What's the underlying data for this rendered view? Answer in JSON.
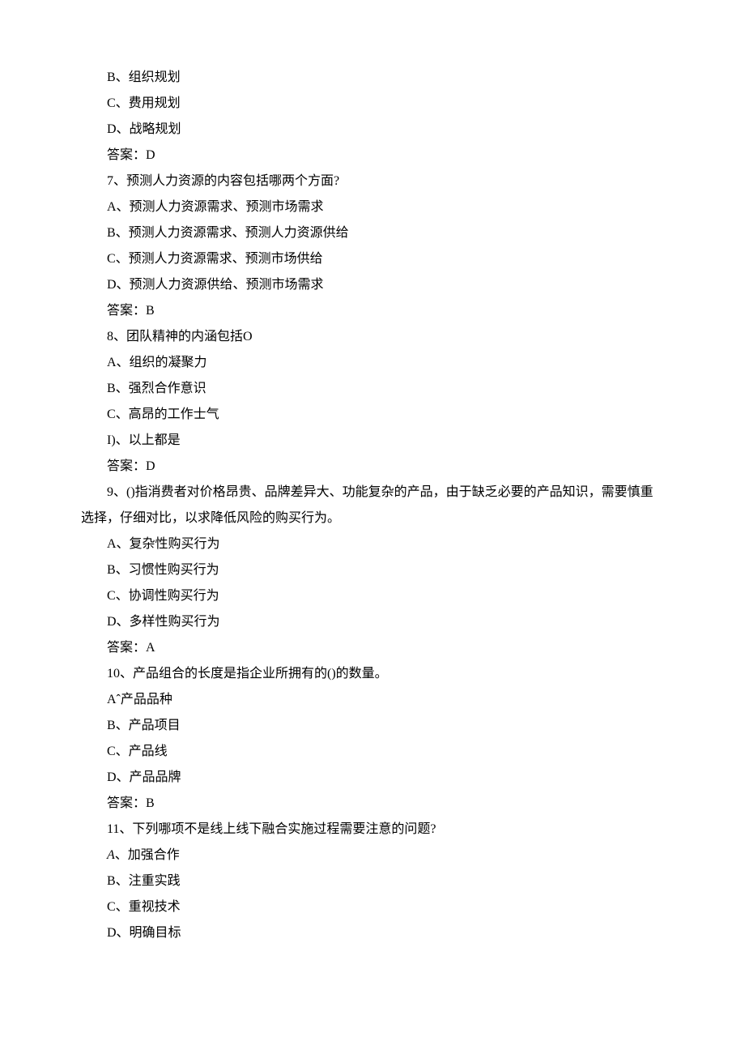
{
  "lines": [
    {
      "text": "B、组织规划",
      "indent": true
    },
    {
      "text": "C、费用规划",
      "indent": true
    },
    {
      "text": "D、战略规划",
      "indent": true
    },
    {
      "text": "答案：D",
      "indent": true
    },
    {
      "text": "7、预测人力资源的内容包括哪两个方面?",
      "indent": true
    },
    {
      "text": "A、预测人力资源需求、预测市场需求",
      "indent": true
    },
    {
      "text": "B、预测人力资源需求、预测人力资源供给",
      "indent": true
    },
    {
      "text": "C、预测人力资源需求、预测市场供给",
      "indent": true
    },
    {
      "text": "D、预测人力资源供给、预测市场需求",
      "indent": true
    },
    {
      "text": "答案：B",
      "indent": true
    },
    {
      "text": "8、团队精神的内涵包括O",
      "indent": true
    },
    {
      "text": "A、组织的凝聚力",
      "indent": true
    },
    {
      "text": "B、强烈合作意识",
      "indent": true
    },
    {
      "text": "C、高昂的工作士气",
      "indent": true
    },
    {
      "text": "I)、以上都是",
      "indent": true
    },
    {
      "text": "答案：D",
      "indent": true
    },
    {
      "text": "9、()指消费者对价格昂贵、品牌差异大、功能复杂的产品，由于缺乏必要的产品知识，需要慎重选择，仔细对比，以求降低风险的购买行为。",
      "indent": true,
      "para": true
    },
    {
      "text": "A、复杂性购买行为",
      "indent": true
    },
    {
      "text": "B、习惯性购买行为",
      "indent": true
    },
    {
      "text": "C、协调性购买行为",
      "indent": true
    },
    {
      "text": "D、多样性购买行为",
      "indent": true
    },
    {
      "text": "答案：A",
      "indent": true
    },
    {
      "text": "10、产品组合的长度是指企业所拥有的()的数量。",
      "indent": true
    },
    {
      "text": "Aˆ产品品种",
      "indent": true
    },
    {
      "text": "B、产品项目",
      "indent": true
    },
    {
      "text": "C、产品线",
      "indent": true
    },
    {
      "text": "D、产品品牌",
      "indent": true
    },
    {
      "text": "答案：B",
      "indent": true
    },
    {
      "text": "11、下列哪项不是线上线下融合实施过程需要注意的问题?",
      "indent": true
    },
    {
      "text": "、加强合作",
      "indent": true,
      "italicA": true
    },
    {
      "text": "B、注重实践",
      "indent": true
    },
    {
      "text": "C、重视技术",
      "indent": true
    },
    {
      "text": "D、明确目标",
      "indent": true
    }
  ]
}
